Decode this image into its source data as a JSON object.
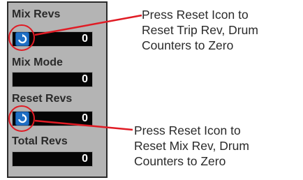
{
  "panel": {
    "items": [
      {
        "label": "Mix Revs",
        "value": "0",
        "has_reset": true
      },
      {
        "label": "Mix Mode",
        "value": "0",
        "has_reset": false
      },
      {
        "label": "Reset Revs",
        "value": "0",
        "has_reset": true
      },
      {
        "label": "Total Revs",
        "value": "0",
        "has_reset": false
      }
    ]
  },
  "callouts": {
    "top": [
      "Press Reset Icon to",
      "Reset Trip Rev, Drum",
      "Counters to Zero"
    ],
    "bottom": [
      "Press Reset Icon to",
      "Reset Mix Rev, Drum",
      "Counters to Zero"
    ]
  },
  "colors": {
    "panel_bg": "#b4b4b4",
    "value_bg": "#050505",
    "reset_icon": "#1f6fc4",
    "highlight": "#e01b24"
  },
  "icons": {
    "reset": "refresh-icon"
  }
}
